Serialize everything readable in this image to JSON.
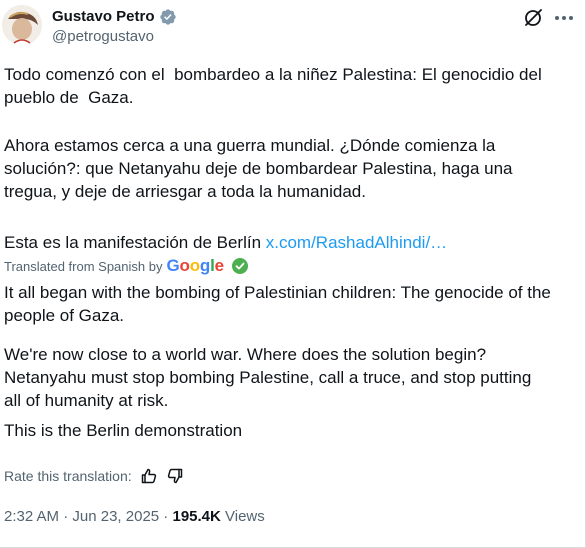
{
  "author": {
    "display_name": "Gustavo Petro",
    "handle": "@petrogustavo"
  },
  "icons": {
    "verified": "verified-badge-icon",
    "grok": "grok-icon",
    "more": "more-options-icon",
    "check": "check-badge-icon",
    "thumbs_up": "thumbs-up-icon",
    "thumbs_down": "thumbs-down-icon"
  },
  "colors": {
    "text": "#0f1419",
    "secondary": "#536471",
    "link": "#1d9bf0",
    "verified_gray": "#829aab",
    "check_green": "#4caf50"
  },
  "original": {
    "paragraph1": "Todo comenzó con el  bombardeo a la niñez Palestina: El genocidio del\npueblo de  Gaza.",
    "paragraph2": "Ahora estamos cerca a una guerra mundial. ¿Dónde comienza la\nsolución?: que Netanyahu deje de bombardear Palestina, haga una\ntregua, y deje de arriesgar a toda la humanidad.",
    "paragraph3": "Esta es la manifestación de Berlín ",
    "link_text": "x.com/RashadAlhindi/…"
  },
  "translation": {
    "label": "Translated from Spanish by",
    "provider": "Google",
    "paragraph1": "It all began with the bombing of Palestinian children: The genocide of the\npeople of Gaza.",
    "paragraph2": "We're now close to a world war. Where does the solution begin?\nNetanyahu must stop bombing Palestine, call a truce, and stop putting\nall of humanity at risk.",
    "paragraph3": "This is the Berlin demonstration",
    "rate_label": "Rate this translation:"
  },
  "meta": {
    "time": "2:32 AM",
    "separator": " · ",
    "date": "Jun 23, 2025",
    "views_count": "195.4K",
    "views_label": " Views"
  }
}
